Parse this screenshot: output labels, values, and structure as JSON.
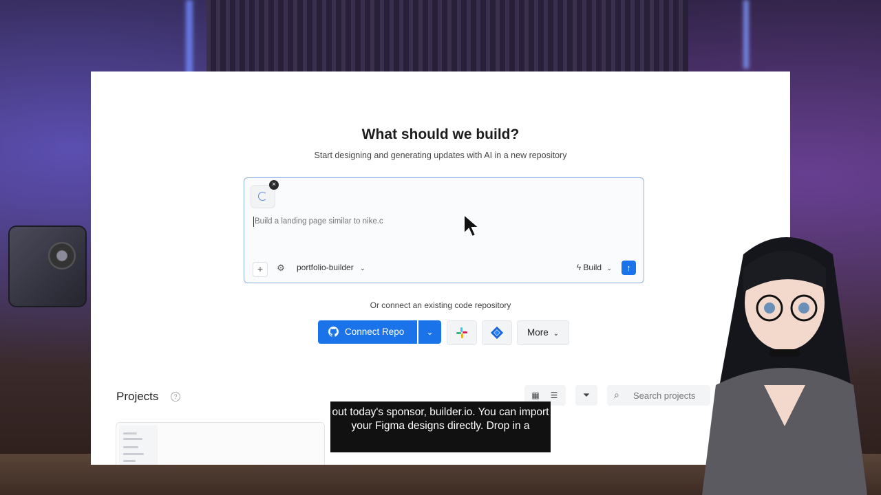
{
  "page": {
    "title": "What should we build?",
    "subtitle": "Start designing and generating updates with AI in a new repository"
  },
  "prompt": {
    "placeholder": "Build a landing page similar to nike.c",
    "repo_label": "portfolio-builder",
    "build_label": "Build"
  },
  "connect": {
    "or_text": "Or connect an existing code repository",
    "connect_label": "Connect Repo",
    "more_label": "More"
  },
  "projects": {
    "heading": "Projects",
    "search_placeholder": "Search projects"
  },
  "caption": {
    "text": "out today's sponsor, builder.io. You can import your Figma designs directly. Drop in a"
  },
  "colors": {
    "accent": "#1a73e8",
    "caption_bg": "#111111"
  },
  "icons": [
    "close-icon",
    "spinner-icon",
    "plus-icon",
    "settings-icon",
    "lightning-icon",
    "arrow-up-icon",
    "github-icon",
    "chevron-down-icon",
    "slack-icon",
    "jira-icon",
    "grid-view-icon",
    "list-view-icon",
    "filter-icon",
    "search-icon",
    "help-icon",
    "cursor-icon"
  ]
}
